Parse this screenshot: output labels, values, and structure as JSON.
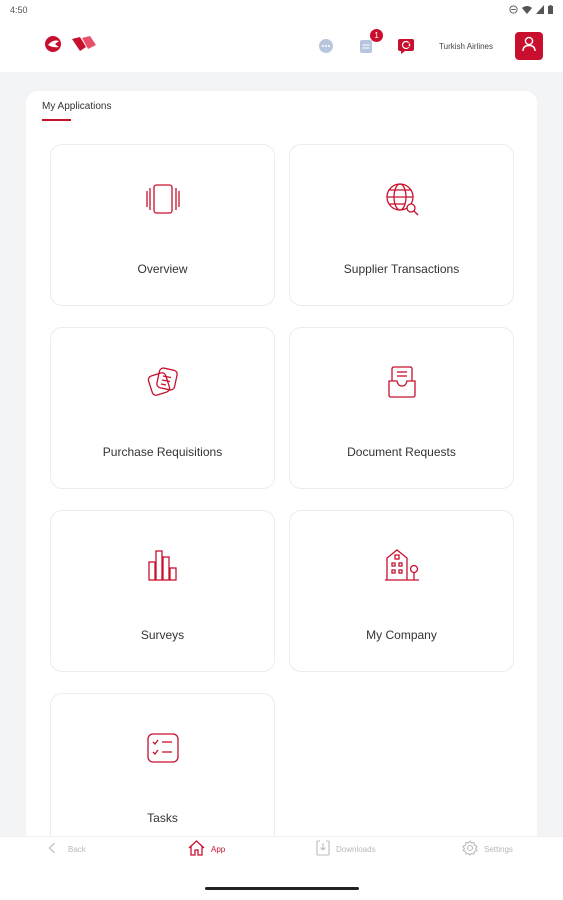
{
  "status_bar": {
    "time": "4:50"
  },
  "header": {
    "company_name": "Turkish Airlines",
    "notification_count": "1",
    "icons": [
      "brand-logo-icon",
      "chat-icon",
      "notes-icon",
      "language-icon",
      "profile-icon"
    ]
  },
  "main": {
    "section_title": "My Applications",
    "apps": [
      {
        "label": "Overview",
        "icon": "overview-icon"
      },
      {
        "label": "Supplier Transactions",
        "icon": "globe-search-icon"
      },
      {
        "label": "Purchase Requisitions",
        "icon": "requisition-icon"
      },
      {
        "label": "Document Requests",
        "icon": "document-inbox-icon"
      },
      {
        "label": "Surveys",
        "icon": "bar-chart-icon"
      },
      {
        "label": "My Company",
        "icon": "building-icon"
      },
      {
        "label": "Tasks",
        "icon": "tasks-icon"
      }
    ]
  },
  "bottom_nav": {
    "items": [
      {
        "label": "Back",
        "icon": "back-icon",
        "active": false
      },
      {
        "label": "App",
        "icon": "home-icon",
        "active": true
      },
      {
        "label": "Downloads",
        "icon": "download-icon",
        "active": false
      },
      {
        "label": "Settings",
        "icon": "settings-icon",
        "active": false
      }
    ]
  },
  "colors": {
    "accent": "#c8102e",
    "background": "#f3f4f6",
    "card_border": "#ececec"
  }
}
